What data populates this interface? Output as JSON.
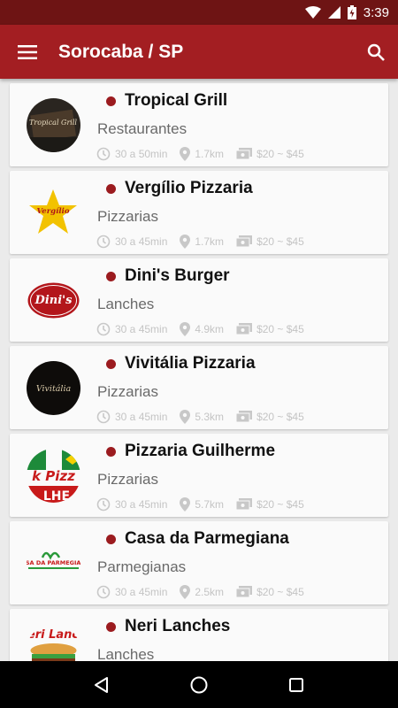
{
  "status_bar": {
    "time": "3:39",
    "icons": [
      "wifi-icon",
      "signal-icon",
      "battery-charging-icon"
    ]
  },
  "app_bar": {
    "title": "Sorocaba / SP",
    "menu_icon": "menu-icon",
    "search_icon": "search-icon"
  },
  "colors": {
    "status_bar": "#6e1414",
    "app_bar": "#a31e22",
    "dot": "#9b1b1f",
    "meta_text": "#c4c4c4",
    "category_text": "#6a6a6a"
  },
  "restaurants": [
    {
      "name": "Tropical Grill",
      "category": "Restaurantes",
      "time": "30 a 50min",
      "distance": "1.7km",
      "price": "$20 ~ $45",
      "logo": "Tropical Grill"
    },
    {
      "name": "Vergílio Pizzaria",
      "category": "Pizzarias",
      "time": "30 a 45min",
      "distance": "1.7km",
      "price": "$20 ~ $45",
      "logo": "Vergílio"
    },
    {
      "name": "Dini's Burger",
      "category": "Lanches",
      "time": "30 a 45min",
      "distance": "4.9km",
      "price": "$20 ~ $45",
      "logo": "Dini's"
    },
    {
      "name": "Vivitália Pizzaria",
      "category": "Pizzarias",
      "time": "30 a 45min",
      "distance": "5.3km",
      "price": "$20 ~ $45",
      "logo": "Vivitália"
    },
    {
      "name": "Pizzaria Guilherme",
      "category": "Pizzarias",
      "time": "30 a 45min",
      "distance": "5.7km",
      "price": "$20 ~ $45",
      "logo": "k Pizz"
    },
    {
      "name": "Casa da Parmegiana",
      "category": "Parmegianas",
      "time": "30 a 45min",
      "distance": "2.5km",
      "price": "$20 ~ $45",
      "logo": "CASA DA PARMEGIANA"
    },
    {
      "name": "Neri Lanches",
      "category": "Lanches",
      "time": "",
      "distance": "",
      "price": "",
      "logo": "eri Lanc"
    }
  ],
  "nav_bar": {
    "icons": [
      "back-icon",
      "home-icon",
      "recents-icon"
    ]
  }
}
